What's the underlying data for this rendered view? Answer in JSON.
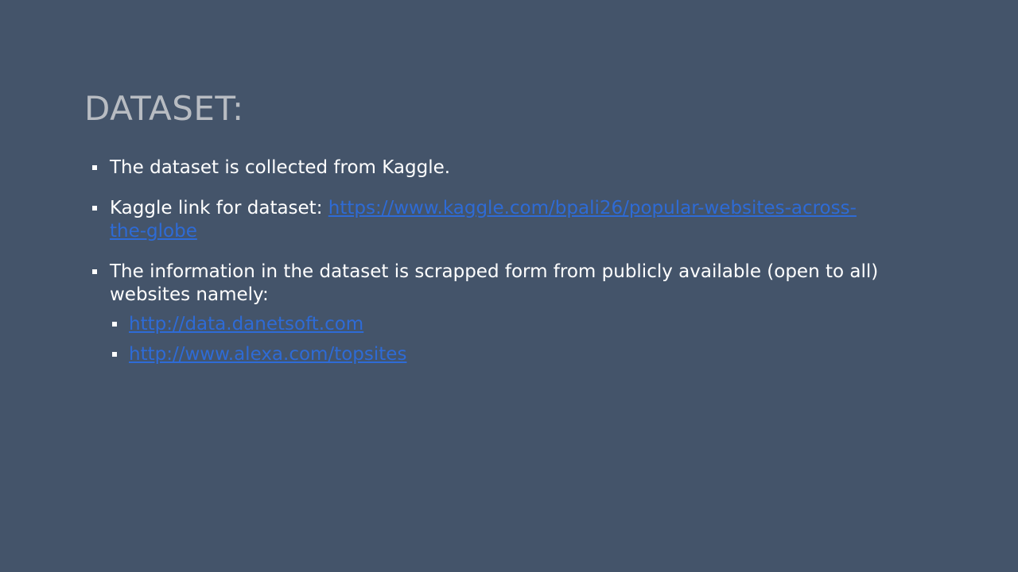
{
  "slide": {
    "title": "DATASET:",
    "bullets": [
      {
        "text": "The dataset is collected from Kaggle."
      },
      {
        "text": "Kaggle link for dataset: ",
        "link": "https://www.kaggle.com/bpali26/popular-websites-across-the-globe"
      },
      {
        "text": "The information in the dataset is scrapped form from publicly available (open to all) websites namely:"
      }
    ],
    "sub_bullets": [
      {
        "link": "http://data.danetsoft.com"
      },
      {
        "link": "http://www.alexa.com/topsites"
      }
    ]
  },
  "colors": {
    "background": "#44546a",
    "title": "#b8bcc2",
    "body_text": "#ffffff",
    "link": "#2e6bd6"
  }
}
